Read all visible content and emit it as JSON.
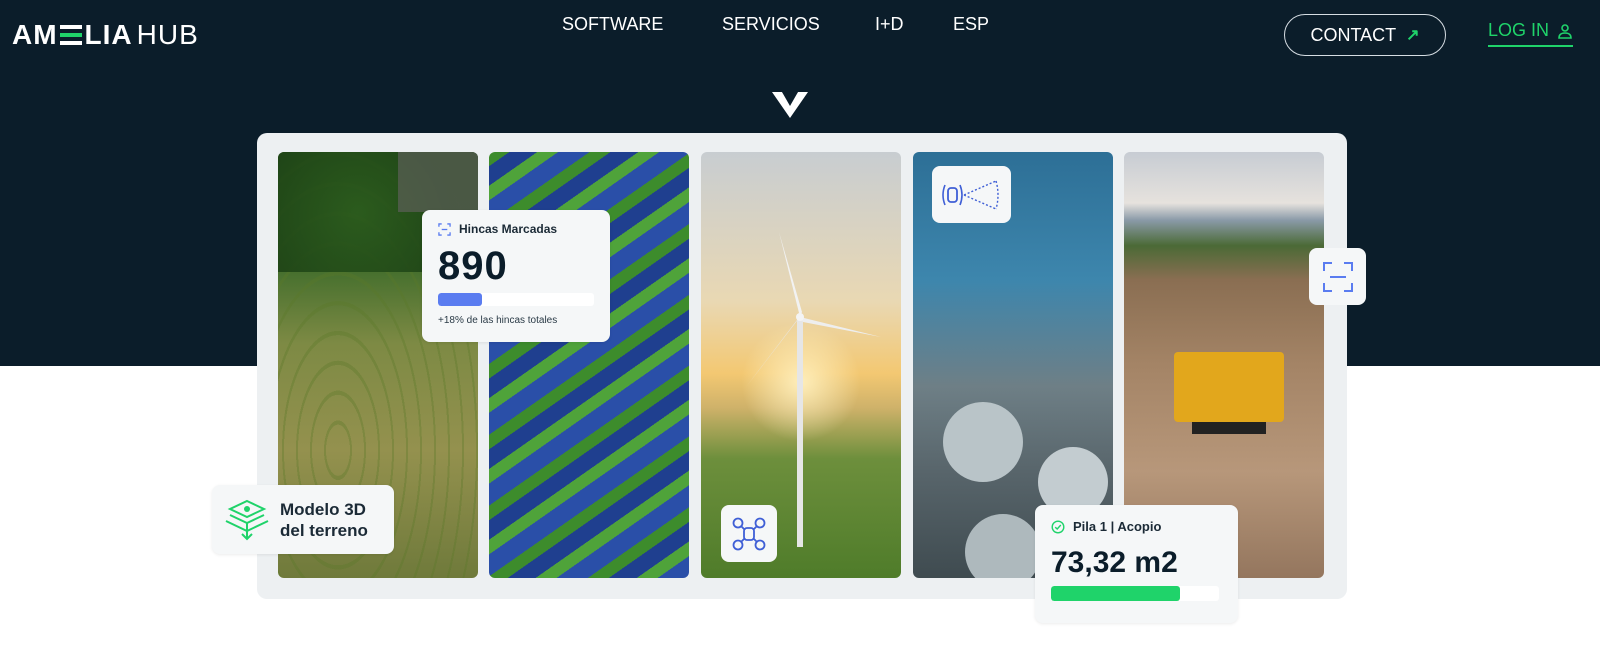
{
  "header": {
    "logo_left": "AM",
    "logo_mid": "LIA",
    "logo_right": "HUB",
    "nav": [
      {
        "label": "SOFTWARE"
      },
      {
        "label": "SERVICIOS"
      },
      {
        "label": "I+D"
      },
      {
        "label": "ESP"
      }
    ],
    "contact_label": "CONTACT",
    "login_label": "LOG IN"
  },
  "cards": {
    "hincas": {
      "title": "Hincas Marcadas",
      "value": "890",
      "progress": 0.28,
      "subtitle": "+18% de las hincas totales"
    },
    "modelo": {
      "line1": "Modelo 3D",
      "line2": "del terreno"
    },
    "pila": {
      "title": "Pila 1 | Acopio",
      "value": "73,32 m2",
      "progress": 0.77
    }
  },
  "colors": {
    "hero_bg": "#0b1d2a",
    "accent_green": "#1fd36a",
    "accent_blue": "#5a7cf0"
  },
  "icons": [
    "arrow-up-right-icon",
    "user-icon",
    "scan-frame-icon",
    "sensor-icon",
    "drone-icon",
    "terrain-layers-icon",
    "check-circle-icon"
  ]
}
